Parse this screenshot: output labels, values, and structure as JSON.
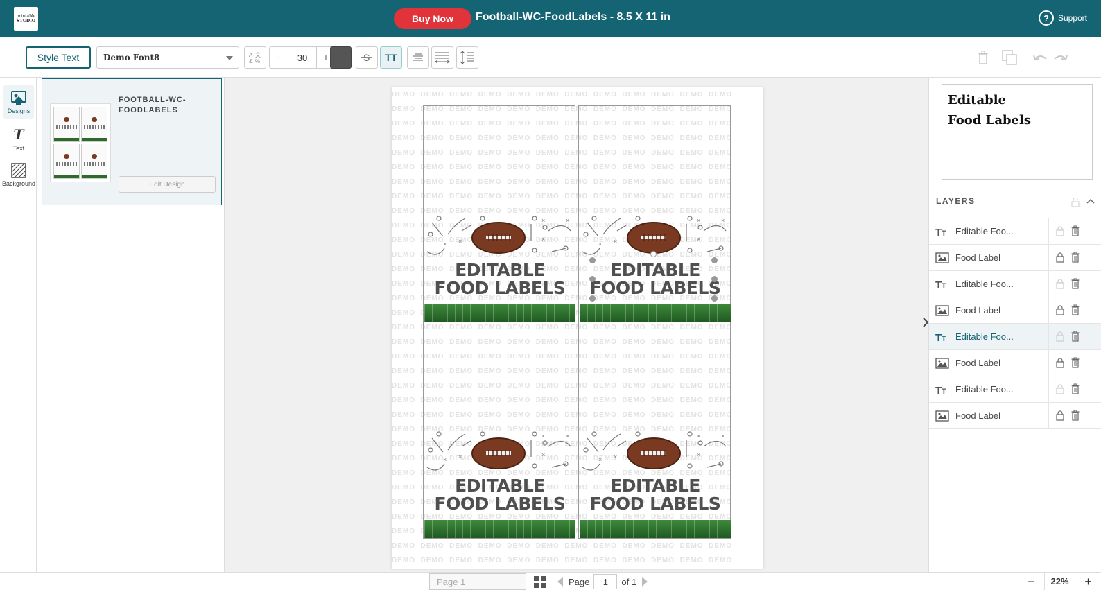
{
  "topbar": {
    "logo_lines": [
      "printable",
      "STUDIO"
    ],
    "buy_now": "Buy Now",
    "doc_title": "Football-WC-FoodLabels - 8.5 X 11 in",
    "support": "Support"
  },
  "toolbar": {
    "style_text": "Style Text",
    "font_name": "Demo Font8",
    "font_size": "30",
    "minus": "−",
    "plus": "+",
    "caps": "TT",
    "text_color": "#555555"
  },
  "rail": {
    "designs": "Designs",
    "text": "Text",
    "background": "Background"
  },
  "designs_panel": {
    "design_name": "FOOTBALL-WC-FOODLABELS",
    "edit_design": "Edit Design"
  },
  "canvas": {
    "watermark_word": "DEMO",
    "label_text_line1": "EDITABLE",
    "label_text_line2": "FOOD LABELS",
    "labels": [
      {
        "line1": "EDITABLE",
        "line2": "FOOD LABELS"
      },
      {
        "line1": "EDITABLE",
        "line2": "FOOD LABELS"
      },
      {
        "line1": "EDITABLE",
        "line2": "FOOD LABELS"
      },
      {
        "line1": "EDITABLE",
        "line2": "FOOD LABELS"
      }
    ]
  },
  "right_panel": {
    "preview_text": "Editable\nFood Labels",
    "layers_title": "LAYERS",
    "layers": [
      {
        "type": "text",
        "name": "Editable Foo..."
      },
      {
        "type": "image",
        "name": "Food Label"
      },
      {
        "type": "text",
        "name": "Editable Foo..."
      },
      {
        "type": "image",
        "name": "Food Label"
      },
      {
        "type": "text",
        "name": "Editable Foo...",
        "selected": true
      },
      {
        "type": "image",
        "name": "Food Label"
      },
      {
        "type": "text",
        "name": "Editable Foo..."
      },
      {
        "type": "image",
        "name": "Food Label"
      }
    ]
  },
  "bottombar": {
    "page_select": "Page 1",
    "page_label": "Page",
    "page_number": "1",
    "page_of": "of 1",
    "zoom": "22%",
    "zoom_minus": "−",
    "zoom_plus": "+"
  },
  "colors": {
    "brand": "#146473",
    "buy_now": "#e0333a",
    "grass": "#2f6a2c",
    "football": "#7a3a22"
  }
}
